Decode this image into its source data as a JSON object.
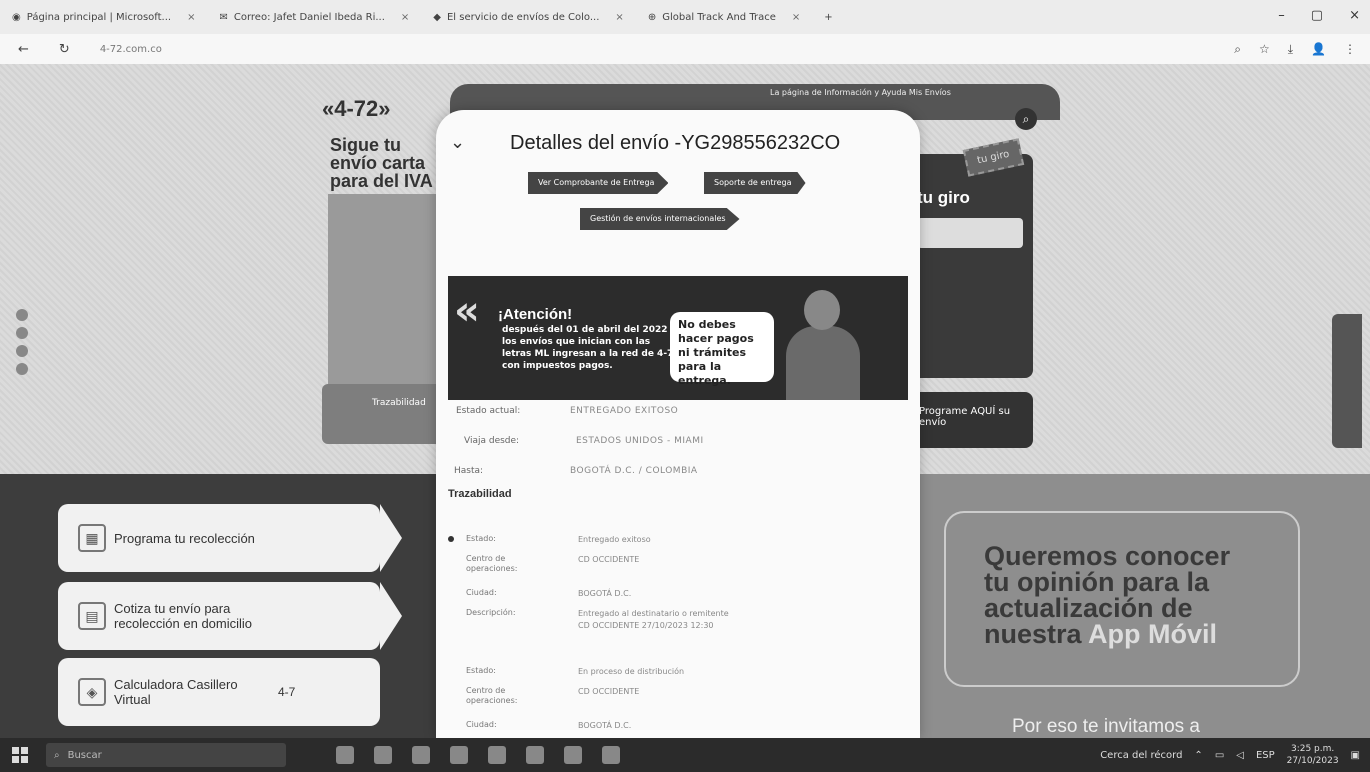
{
  "browser": {
    "tabs": [
      {
        "icon": "edge-icon",
        "label": "Página principal | Microsoft..."
      },
      {
        "icon": "outlook-icon",
        "label": "Correo: Jafet Daniel Ibeda Ri..."
      },
      {
        "icon": "site-icon",
        "label": "El servicio de envíos de Colo..."
      },
      {
        "icon": "globe-icon",
        "label": "Global Track And Trace"
      }
    ],
    "new_tab": "+",
    "url": "4-72.com.co",
    "nav": {
      "back": "←",
      "reload": "↻"
    }
  },
  "site": {
    "logo": "«4-72»",
    "promo": "Sigue tu envío carta para del IVA",
    "header_links": "La página de Información y Ayuda   Mis Envíos",
    "giro_title": "tu giro",
    "giro_tag": "tu giro",
    "giro_link": "Programe AQUÍ su envío",
    "inner_banner": "Trazabilidad",
    "cards": [
      {
        "icon": "calendar-icon",
        "label": "Programa tu recolección"
      },
      {
        "icon": "calculator-icon",
        "label": "Cotiza tu envío para\nrecolección en domicilio"
      },
      {
        "icon": "box-icon",
        "label": "Calculadora Casillero\nVirtual",
        "tail": "4-7"
      }
    ],
    "opinion": {
      "line1": "Queremos conocer",
      "line2": "tu opinión para la",
      "line3": "actualización de",
      "line4": "nuestra",
      "highlight": "App Móvil",
      "sub": "Por eso te invitamos a"
    }
  },
  "modal": {
    "title": "Detalles del envío -YG298556232CO",
    "buttons": {
      "comprobante": "Ver Comprobante de Entrega",
      "soporte": "Soporte de entrega",
      "gestion": "Gestión de envíos internacionales"
    },
    "attention": {
      "heading": "¡Atención!",
      "body": "después del 01 de abril del 2022 los envíos que inician con las letras ML ingresan a la red de 4-72 con impuestos pagos.",
      "bubble": "No debes hacer pagos ni trámites para la entrega."
    },
    "summary": [
      {
        "key": "Estado actual:",
        "value": "ENTREGADO EXITOSO"
      },
      {
        "key": "Viaja desde:",
        "value": "ESTADOS UNIDOS - MIAMI"
      },
      {
        "key": "Hasta:",
        "value": "BOGOTÁ D.C. / COLOMBIA"
      }
    ],
    "trazabilidad_label": "Trazabilidad",
    "events": [
      {
        "key": "Estado:",
        "value": "Entregado exitoso"
      },
      {
        "key": "Centro de operaciones:",
        "value": "CD OCCIDENTE"
      },
      {
        "key": "Ciudad:",
        "value": "BOGOTÁ D.C."
      },
      {
        "key": "Descripción:",
        "value": "Entregado al destinatario o remitente\nCD OCCIDENTE 27/10/2023 12:30"
      },
      {
        "key": "Estado:",
        "value": "En proceso de distribución"
      },
      {
        "key": "Centro de operaciones:",
        "value": "CD OCCIDENTE"
      },
      {
        "key": "Ciudad:",
        "value": "BOGOTÁ D.C."
      }
    ]
  },
  "taskbar": {
    "search": "Buscar",
    "weather": "Cerca del récord",
    "lang": "ESP",
    "time": "3:25 p.m.",
    "date": "27/10/2023"
  }
}
